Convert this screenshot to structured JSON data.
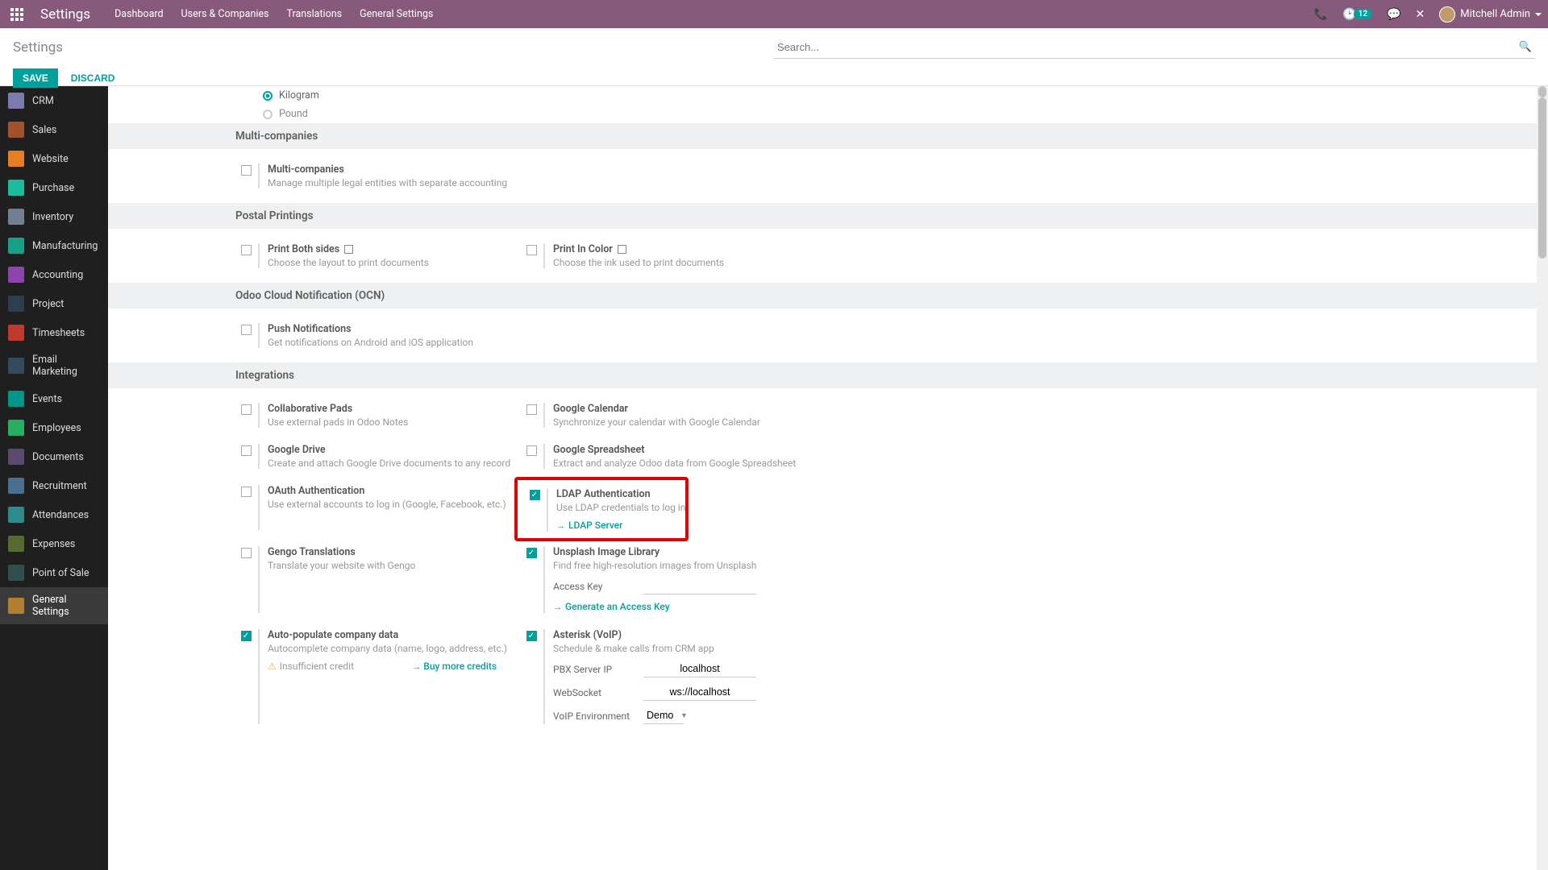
{
  "header": {
    "app_name": "Settings",
    "nav": [
      "Dashboard",
      "Users & Companies",
      "Translations",
      "General Settings"
    ],
    "badge_count": "12",
    "user_name": "Mitchell Admin"
  },
  "control_panel": {
    "breadcrumb": "Settings",
    "search_placeholder": "Search...",
    "save_label": "SAVE",
    "discard_label": "DISCARD"
  },
  "sidebar": {
    "items": [
      {
        "label": "CRM",
        "color": "#7c7bad"
      },
      {
        "label": "Sales",
        "color": "#a0522d"
      },
      {
        "label": "Website",
        "color": "#e67e22"
      },
      {
        "label": "Purchase",
        "color": "#1abc9c"
      },
      {
        "label": "Inventory",
        "color": "#708090"
      },
      {
        "label": "Manufacturing",
        "color": "#16a085"
      },
      {
        "label": "Accounting",
        "color": "#8e44ad"
      },
      {
        "label": "Project",
        "color": "#2c3e50"
      },
      {
        "label": "Timesheets",
        "color": "#c0392b"
      },
      {
        "label": "Email Marketing",
        "color": "#34495e"
      },
      {
        "label": "Events",
        "color": "#009688"
      },
      {
        "label": "Employees",
        "color": "#27ae60"
      },
      {
        "label": "Documents",
        "color": "#5b4a6e"
      },
      {
        "label": "Recruitment",
        "color": "#4a6e8e"
      },
      {
        "label": "Attendances",
        "color": "#2e8b8b"
      },
      {
        "label": "Expenses",
        "color": "#556b2f"
      },
      {
        "label": "Point of Sale",
        "color": "#2f4f4f"
      },
      {
        "label": "General Settings",
        "color": "#b08030"
      }
    ]
  },
  "radios": {
    "kilogram": "Kilogram",
    "pound": "Pound"
  },
  "sections": {
    "multi_companies": {
      "head": "Multi-companies",
      "title": "Multi-companies",
      "sub": "Manage multiple legal entities with separate accounting"
    },
    "postal": {
      "head": "Postal Printings",
      "both": {
        "title": "Print Both sides",
        "sub": "Choose the layout to print documents"
      },
      "color": {
        "title": "Print In Color",
        "sub": "Choose the ink used to print documents"
      }
    },
    "ocn": {
      "head": "Odoo Cloud Notification (OCN)",
      "push": {
        "title": "Push Notifications",
        "sub": "Get notifications on Android and iOS application"
      }
    },
    "integrations": {
      "head": "Integrations",
      "pads": {
        "title": "Collaborative Pads",
        "sub": "Use external pads in Odoo Notes"
      },
      "gcal": {
        "title": "Google Calendar",
        "sub": "Synchronize your calendar with Google Calendar"
      },
      "gdrive": {
        "title": "Google Drive",
        "sub": "Create and attach Google Drive documents to any record"
      },
      "gsheet": {
        "title": "Google Spreadsheet",
        "sub": "Extract and analyze Odoo data from Google Spreadsheet"
      },
      "oauth": {
        "title": "OAuth Authentication",
        "sub": "Use external accounts to log in (Google, Facebook, etc.)"
      },
      "ldap": {
        "title": "LDAP Authentication",
        "sub": "Use LDAP credentials to log in",
        "link": "LDAP Server"
      },
      "gengo": {
        "title": "Gengo Translations",
        "sub": "Translate your website with Gengo"
      },
      "unsplash": {
        "title": "Unsplash Image Library",
        "sub": "Find free high-resolution images from Unsplash",
        "access_key_label": "Access Key",
        "gen_link": "Generate an Access Key"
      },
      "autopop": {
        "title": "Auto-populate company data",
        "sub": "Autocomplete company data (name, logo, address, etc.)",
        "warn": "Insufficient credit",
        "buy": "Buy more credits"
      },
      "asterisk": {
        "title": "Asterisk (VoIP)",
        "sub": "Schedule & make calls from CRM app",
        "pbx_label": "PBX Server IP",
        "pbx_val": "localhost",
        "ws_label": "WebSocket",
        "ws_val": "ws://localhost",
        "env_label": "VoIP Environment",
        "env_val": "Demo"
      }
    }
  }
}
